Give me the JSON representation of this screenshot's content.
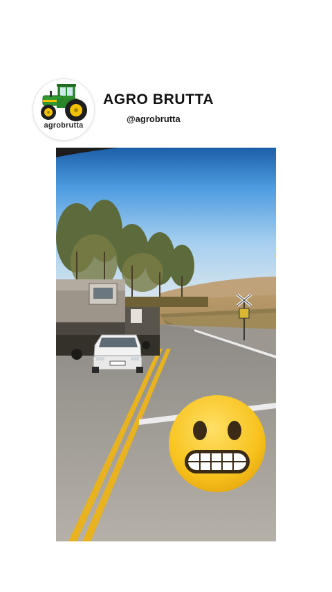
{
  "profile": {
    "name": "AGRO BRUTTA",
    "handle": "@agrobrutta",
    "avatar_text": "agrobrutta",
    "avatar_icon": "tractor-icon"
  },
  "video": {
    "overlay_emoji": "grimacing-face-icon"
  },
  "colors": {
    "tractor_green": "#2e8b2e",
    "tractor_yellow": "#f2c200",
    "emoji_yellow": "#f7c21d",
    "road_line": "#e9b21f"
  }
}
